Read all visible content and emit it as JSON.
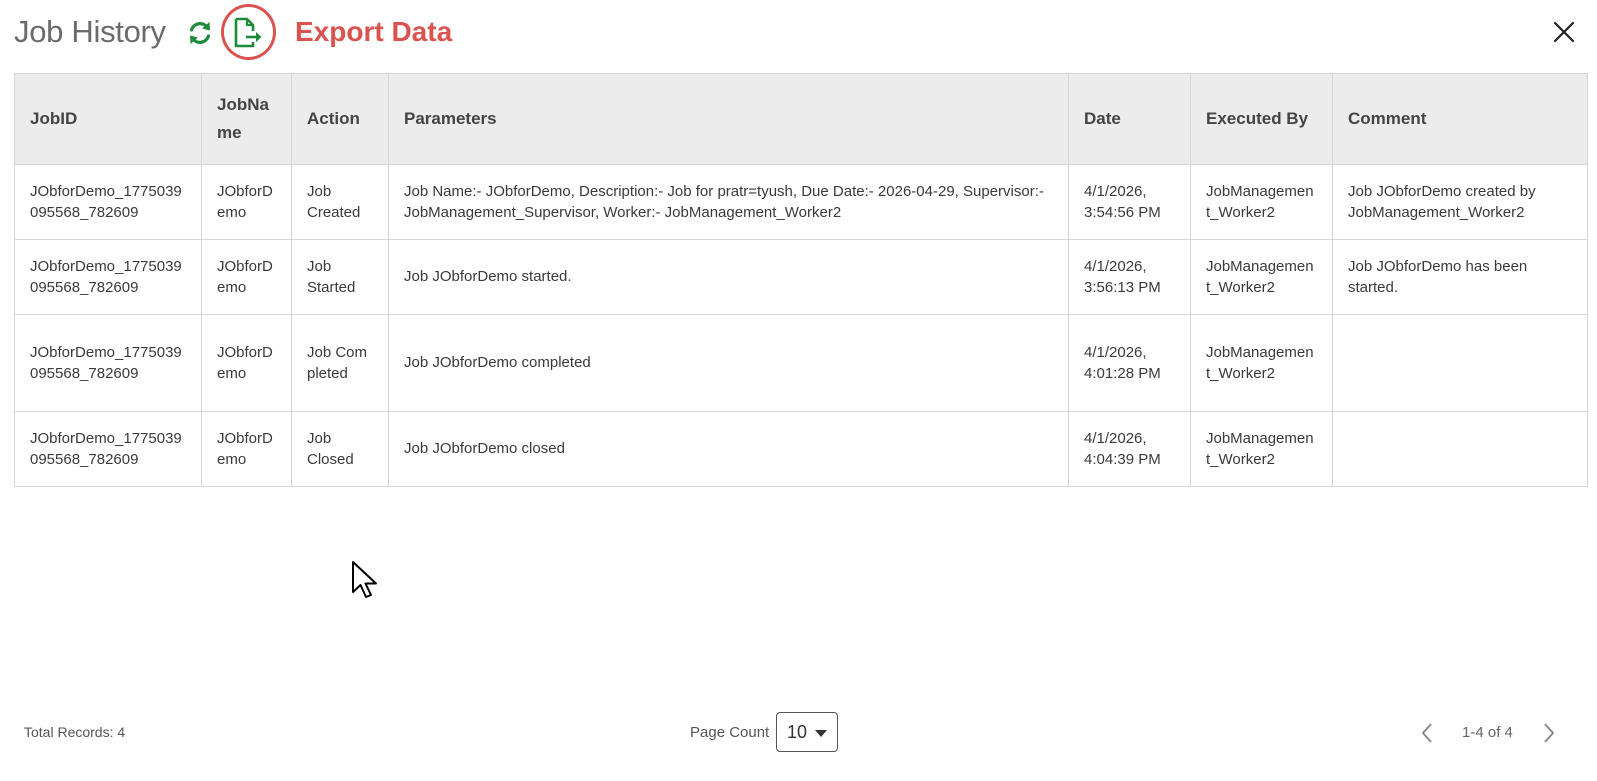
{
  "header": {
    "title": "Job History",
    "annotation": "Export Data",
    "icons": {
      "refresh": "refresh-icon",
      "export": "export-file-icon",
      "close": "close-icon"
    },
    "colors": {
      "accent_green": "#1e8a3c",
      "annotation_red": "#d9534f"
    }
  },
  "table": {
    "columns": [
      "JobID",
      "JobName",
      "Action",
      "Parameters",
      "Date",
      "Executed By",
      "Comment"
    ],
    "rows": [
      {
        "job_id": "JObforDemo_1775039095568_782609",
        "job_name": "JObforDemo",
        "action": "Job Created",
        "parameters": "Job Name:- JObforDemo, Description:- Job for pratr=tyush, Due Date:- 2026-04-29, Supervisor:- JobManagement_Supervisor, Worker:- JobManagement_Worker2",
        "date": "4/1/2026, 3:54:56 PM",
        "executed_by": "JobManagement_Worker2",
        "comment": "Job JObforDemo created by JobManagement_Worker2"
      },
      {
        "job_id": "JObforDemo_1775039095568_782609",
        "job_name": "JObforDemo",
        "action": "Job Started",
        "parameters": "Job JObforDemo started.",
        "date": "4/1/2026, 3:56:13 PM",
        "executed_by": "JobManagement_Worker2",
        "comment": "Job JObforDemo has been started."
      },
      {
        "job_id": "JObforDemo_1775039095568_782609",
        "job_name": "JObforDemo",
        "action": "Job Completed",
        "parameters": "Job JObforDemo completed",
        "date": "4/1/2026, 4:01:28 PM",
        "executed_by": "JobManagement_Worker2",
        "comment": ""
      },
      {
        "job_id": "JObforDemo_1775039095568_782609",
        "job_name": "JObforDemo",
        "action": "Job Closed",
        "parameters": "Job JObforDemo closed",
        "date": "4/1/2026, 4:04:39 PM",
        "executed_by": "JobManagement_Worker2",
        "comment": ""
      }
    ]
  },
  "footer": {
    "total_records": "Total Records: 4",
    "page_count_label": "Page Count",
    "page_count_value": "10",
    "range": "1-4 of 4",
    "icons": {
      "prev": "chevron-left-icon",
      "next": "chevron-right-icon",
      "dropdown": "caret-down-icon"
    }
  }
}
